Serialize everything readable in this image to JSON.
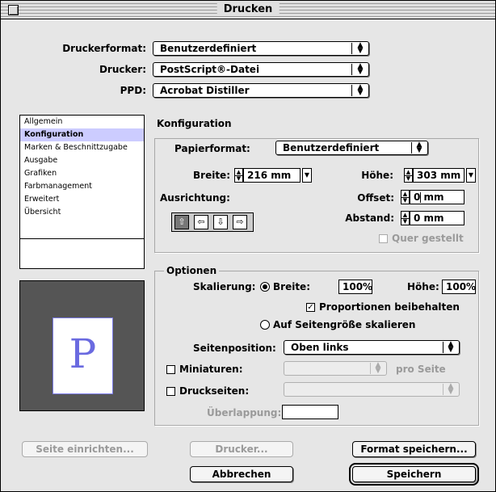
{
  "window": {
    "title": "Drucken"
  },
  "header": {
    "format_label": "Druckerformat:",
    "format_value": "Benutzerdefiniert",
    "printer_label": "Drucker:",
    "printer_value": "PostScript®-Datei",
    "ppd_label": "PPD:",
    "ppd_value": "Acrobat Distiller"
  },
  "sidebar": {
    "items": [
      {
        "label": "Allgemein"
      },
      {
        "label": "Konfiguration",
        "selected": true
      },
      {
        "label": "Marken & Beschnittzugabe"
      },
      {
        "label": "Ausgabe"
      },
      {
        "label": "Grafiken"
      },
      {
        "label": "Farbmanagement"
      },
      {
        "label": "Erweitert"
      },
      {
        "label": "Übersicht"
      }
    ]
  },
  "preview": {
    "letter": "P"
  },
  "config": {
    "heading": "Konfiguration",
    "paper_label": "Papierformat:",
    "paper_value": "Benutzerdefiniert",
    "width_label": "Breite:",
    "width_value": "216 mm",
    "height_label": "Höhe:",
    "height_value": "303 mm",
    "orientation_label": "Ausrichtung:",
    "offset_label": "Offset:",
    "offset_value": "0 mm",
    "spacing_label": "Abstand:",
    "spacing_value": "0 mm",
    "transverse_label": "Quer gestellt"
  },
  "options": {
    "legend": "Optionen",
    "scaling_label": "Skalierung:",
    "width_radio_label": "Breite:",
    "width_scale": "100%",
    "height_scale_label": "Höhe:",
    "height_scale": "100%",
    "keep_proportions_label": "Proportionen beibehalten",
    "fit_page_label": "Auf Seitengröße skalieren",
    "page_position_label": "Seitenposition:",
    "page_position_value": "Oben links",
    "thumbnails_label": "Miniaturen:",
    "per_page_label": "pro Seite",
    "tiles_label": "Druckseiten:",
    "overlap_label": "Überlappung:"
  },
  "buttons": {
    "page_setup": "Seite einrichten...",
    "printer": "Drucker...",
    "save_format": "Format speichern...",
    "cancel": "Abbrechen",
    "save": "Speichern"
  }
}
